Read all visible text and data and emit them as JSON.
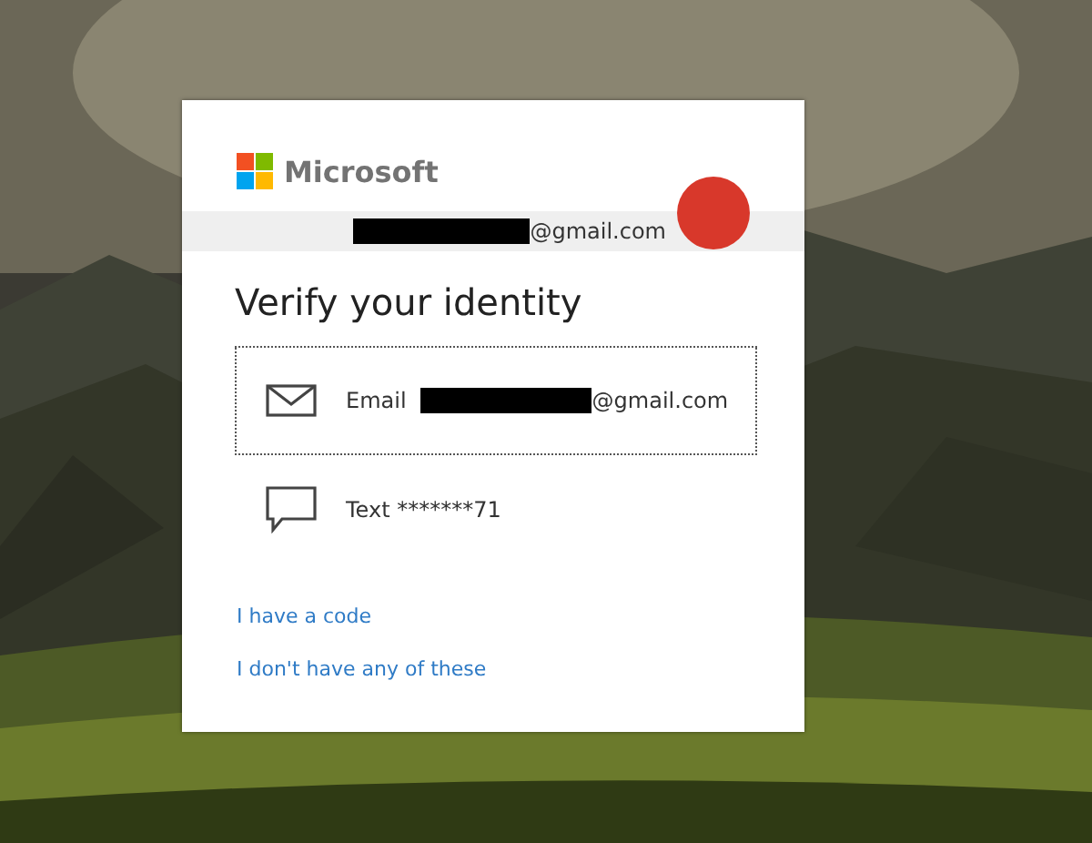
{
  "brand": {
    "name": "Microsoft"
  },
  "account": {
    "redacted": true,
    "email": "@gmail.com"
  },
  "title": "Verify your identity",
  "options": [
    {
      "kind": "email",
      "label": "Email",
      "redacted": true,
      "value": "@gmail.com",
      "selected": true
    },
    {
      "kind": "sms",
      "label": "Text",
      "redacted": false,
      "value": "*******71",
      "selected": false
    }
  ],
  "links": [
    "I have a code",
    "I don't have any of these"
  ]
}
